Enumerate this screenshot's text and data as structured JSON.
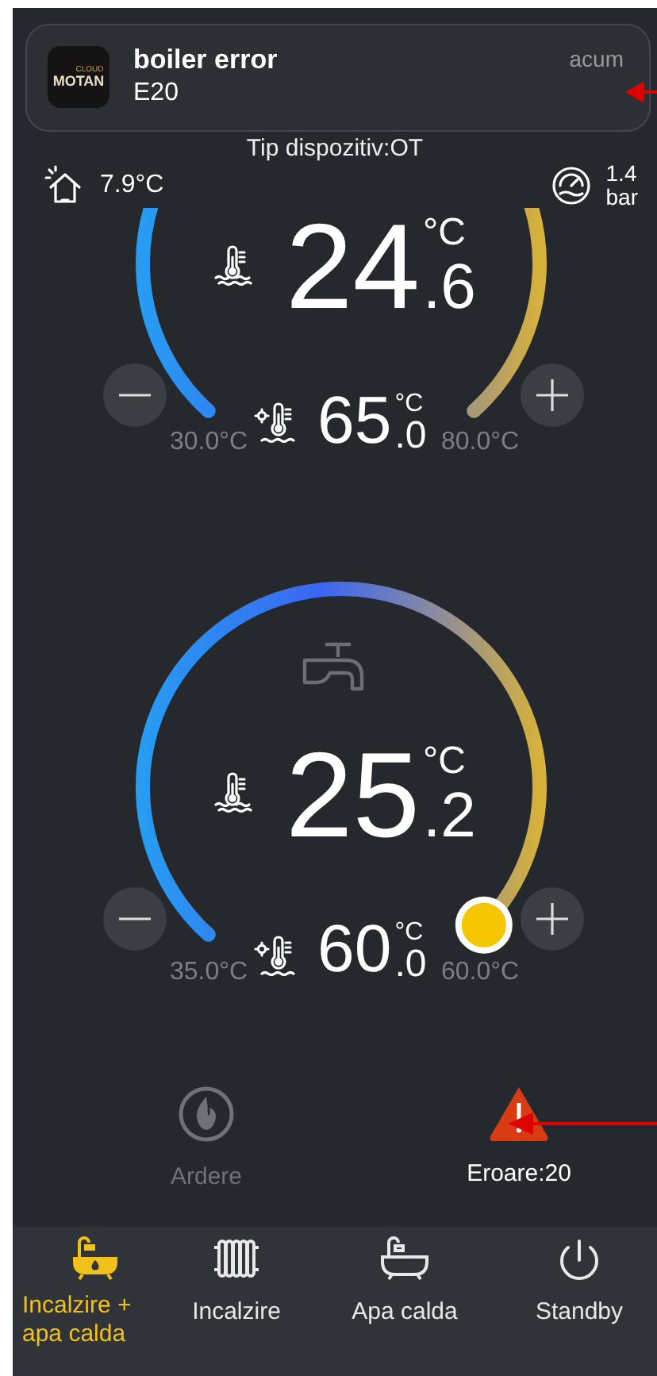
{
  "notification": {
    "logo_small": "CLOUD",
    "logo": "MOTAN",
    "title": "boiler error",
    "body": "E20",
    "time": "acum"
  },
  "device_type": "Tip dispozitiv:OT",
  "outdoor": {
    "temperature": "7.9°C"
  },
  "pressure": {
    "value": "1.4",
    "unit": "bar"
  },
  "gauges": [
    {
      "kind": "heating",
      "current": {
        "integer": "24",
        "decimal": ".6",
        "unit": "°C"
      },
      "setpoint": {
        "integer": "65",
        "decimal": ".0",
        "unit": "°C"
      },
      "min": "30.0°C",
      "max": "80.0°C"
    },
    {
      "kind": "hot_water",
      "current": {
        "integer": "25",
        "decimal": ".2",
        "unit": "°C"
      },
      "setpoint": {
        "integer": "60",
        "decimal": ".0",
        "unit": "°C"
      },
      "min": "35.0°C",
      "max": "60.0°C",
      "level": 1
    }
  ],
  "status": [
    {
      "kind": "flame",
      "label": "Ardere",
      "active": false
    },
    {
      "kind": "error",
      "label": "Eroare:20",
      "active": true
    }
  ],
  "modes": [
    {
      "kind": "heating_hot_water",
      "label": "Incalzire +\napa calda",
      "selected": true
    },
    {
      "kind": "heating",
      "label": "Incalzire",
      "selected": false
    },
    {
      "kind": "hot_water",
      "label": "Apa calda",
      "selected": false
    },
    {
      "kind": "standby",
      "label": "Standby",
      "selected": false
    }
  ]
}
